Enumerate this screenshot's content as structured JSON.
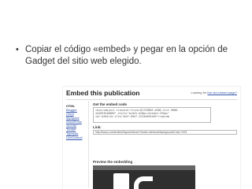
{
  "slide": {
    "bullet_symbol": "•",
    "bullet_text": "Copiar el código «embed» y pegar en la opción de Gadget del sitio web elegido."
  },
  "screenshot": {
    "title": "Embed this publication",
    "top_link_prefix": "Looking for",
    "top_link_text": "the old embed page?",
    "sidebar": [
      {
        "label": "HTML",
        "link": false
      },
      {
        "label": "Blogger",
        "link": true
      },
      {
        "label": "Orkut",
        "link": true
      },
      {
        "label": "MySpace",
        "link": true
      },
      {
        "label": "WordPress",
        "link": true
      },
      {
        "label": "Joomla",
        "link": true
      },
      {
        "label": "Tumblr",
        "link": true
      },
      {
        "label": "Typepad",
        "link": true
      },
      {
        "label": "LiveJournal",
        "link": true
      }
    ],
    "embed_label": "Get the embed code",
    "embed_code_lines": [
      "<div><object classid=\"clsid:D27CDB6E-AE6D-11cf-96B8-",
      "444553540000\" style=\"width:420px;height:294px\"",
      "id=\"a2b5c1e-c7ca-5a2f-69e7-2243e6d2ee0\"><param"
    ],
    "link_label": "Link:",
    "link_value": "http://issuu.com/embed/layout/viewer?mode=window&backgroundColor=%23",
    "preview_label": "Preview the embedding"
  }
}
